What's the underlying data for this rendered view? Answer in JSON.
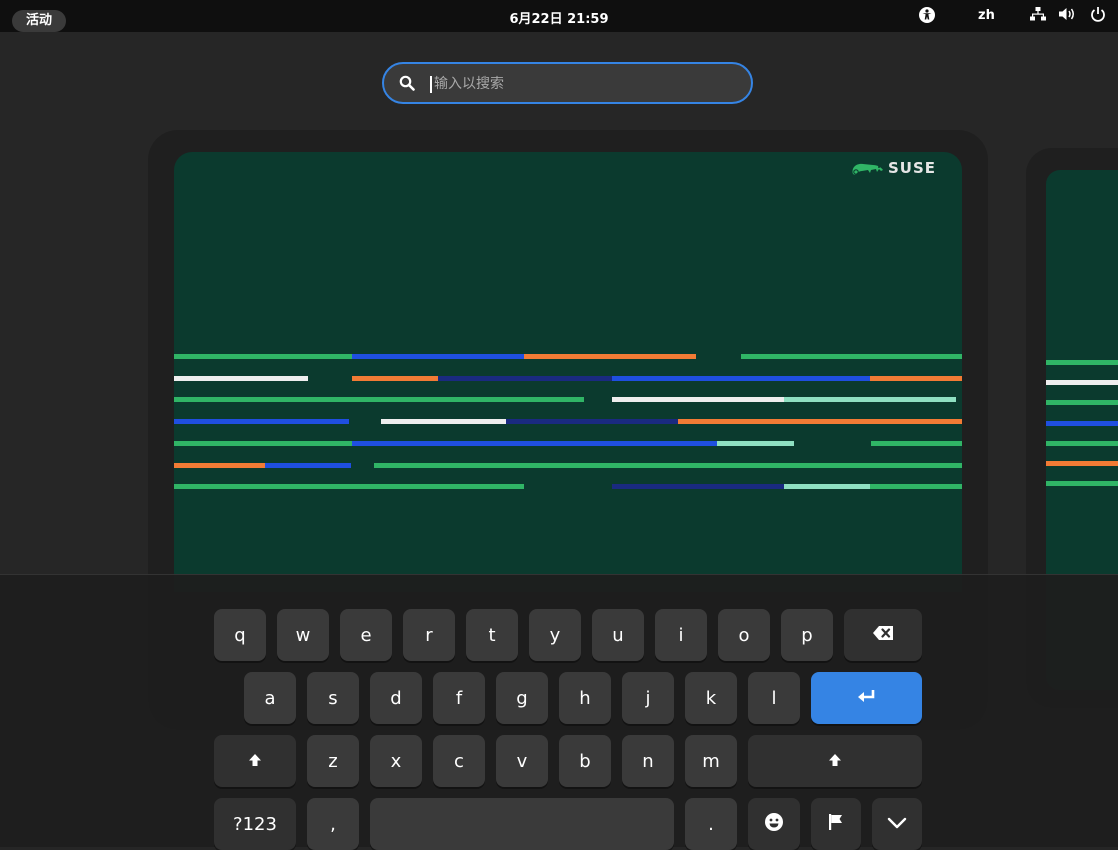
{
  "topbar": {
    "activities_label": "活动",
    "clock": "6月22日 21:59",
    "language": "zh",
    "icons": [
      "accessibility-icon",
      "network-icon",
      "volume-icon",
      "power-icon"
    ]
  },
  "search": {
    "placeholder": "输入以搜索",
    "value": ""
  },
  "window": {
    "brand_text": "SUSE"
  },
  "keyboard": {
    "row1": [
      "q",
      "w",
      "e",
      "r",
      "t",
      "y",
      "u",
      "i",
      "o",
      "p"
    ],
    "row2": [
      "a",
      "s",
      "d",
      "f",
      "g",
      "h",
      "j",
      "k",
      "l"
    ],
    "row3": [
      "z",
      "x",
      "c",
      "v",
      "b",
      "n",
      "m"
    ],
    "row4": {
      "symbols_label": "?123",
      "comma_label": ",",
      "period_label": "."
    },
    "enter_color": "#3584e4",
    "icons": [
      "backspace-icon",
      "enter-icon",
      "shift-icon",
      "emoji-icon",
      "flag-icon",
      "hide-keyboard-icon"
    ]
  },
  "colors": {
    "accent": "#3584e4",
    "wallpaper": "#0b3a2e",
    "stripe_green": "#30b566",
    "stripe_blue": "#1f4fe0",
    "stripe_orange": "#f27b35",
    "stripe_white": "#eeeeee",
    "stripe_navy": "#1a2a80",
    "stripe_mint": "#8fe0c2"
  }
}
